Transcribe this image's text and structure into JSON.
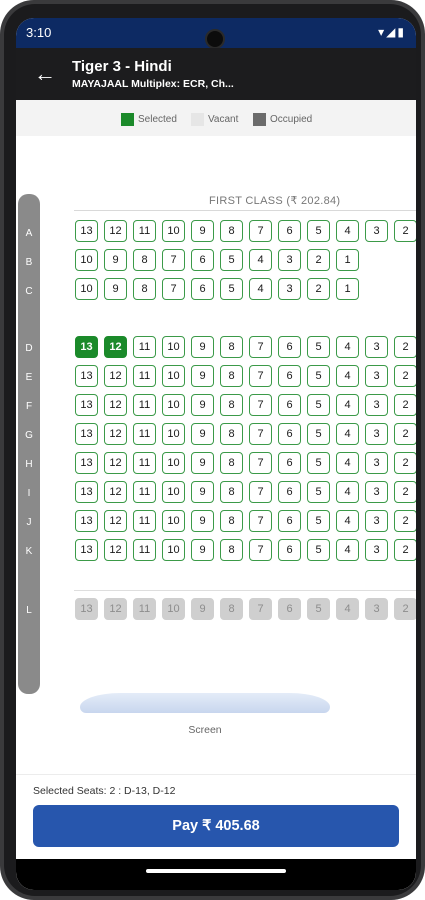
{
  "status_bar": {
    "time": "3:10",
    "icons": "▾◢▮"
  },
  "header": {
    "back_icon": "←",
    "title": "Tiger 3 - Hindi",
    "venue": "MAYAJAAL Multiplex: ECR, Ch..."
  },
  "legend": {
    "items": [
      {
        "label": "Selected",
        "color": "#1b8a2a"
      },
      {
        "label": "Vacant",
        "color": "#e6e6e6"
      },
      {
        "label": "Occupied",
        "color": "#6b6b6b"
      }
    ]
  },
  "section": {
    "title": "FIRST CLASS (₹ 202.84)"
  },
  "row_labels": [
    "A",
    "B",
    "C",
    "D",
    "E",
    "F",
    "G",
    "H",
    "I",
    "J",
    "K",
    "L"
  ],
  "seat_rows": [
    {
      "row": "A",
      "status": "available",
      "seats": [
        "13",
        "12",
        "11",
        "10",
        "9",
        "8",
        "7",
        "6",
        "5",
        "4",
        "3",
        "2"
      ]
    },
    {
      "row": "B",
      "status": "available",
      "seats": [
        "10",
        "9",
        "8",
        "7",
        "6",
        "5",
        "4",
        "3",
        "2",
        "1"
      ]
    },
    {
      "row": "C",
      "status": "available",
      "seats": [
        "10",
        "9",
        "8",
        "7",
        "6",
        "5",
        "4",
        "3",
        "2",
        "1"
      ]
    },
    {
      "row": "D",
      "status": "available",
      "seats": [
        "13",
        "12",
        "11",
        "10",
        "9",
        "8",
        "7",
        "6",
        "5",
        "4",
        "3",
        "2"
      ],
      "selected": [
        "13",
        "12"
      ]
    },
    {
      "row": "E",
      "status": "available",
      "seats": [
        "13",
        "12",
        "11",
        "10",
        "9",
        "8",
        "7",
        "6",
        "5",
        "4",
        "3",
        "2"
      ]
    },
    {
      "row": "F",
      "status": "available",
      "seats": [
        "13",
        "12",
        "11",
        "10",
        "9",
        "8",
        "7",
        "6",
        "5",
        "4",
        "3",
        "2"
      ]
    },
    {
      "row": "G",
      "status": "available",
      "seats": [
        "13",
        "12",
        "11",
        "10",
        "9",
        "8",
        "7",
        "6",
        "5",
        "4",
        "3",
        "2"
      ]
    },
    {
      "row": "H",
      "status": "available",
      "seats": [
        "13",
        "12",
        "11",
        "10",
        "9",
        "8",
        "7",
        "6",
        "5",
        "4",
        "3",
        "2"
      ]
    },
    {
      "row": "I",
      "status": "available",
      "seats": [
        "13",
        "12",
        "11",
        "10",
        "9",
        "8",
        "7",
        "6",
        "5",
        "4",
        "3",
        "2"
      ]
    },
    {
      "row": "J",
      "status": "available",
      "seats": [
        "13",
        "12",
        "11",
        "10",
        "9",
        "8",
        "7",
        "6",
        "5",
        "4",
        "3",
        "2"
      ]
    },
    {
      "row": "K",
      "status": "available",
      "seats": [
        "13",
        "12",
        "11",
        "10",
        "9",
        "8",
        "7",
        "6",
        "5",
        "4",
        "3",
        "2"
      ]
    },
    {
      "row": "L",
      "status": "occupied",
      "seats": [
        "13",
        "12",
        "11",
        "10",
        "9",
        "8",
        "7",
        "6",
        "5",
        "4",
        "3",
        "2"
      ]
    }
  ],
  "screen_label": "Screen",
  "footer": {
    "selected_seats": "Selected Seats: 2 : D-13, D-12",
    "pay_label": "Pay ₹ 405.68"
  }
}
